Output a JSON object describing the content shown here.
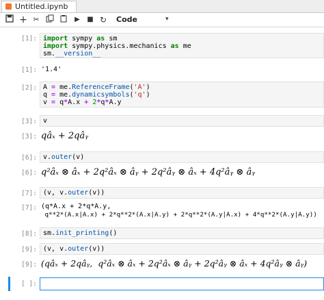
{
  "tab": {
    "title": "Untitled.ipynb"
  },
  "toolbar": {
    "buttons": [
      "save-icon",
      "add-cell-icon",
      "cut-icon",
      "copy-icon",
      "paste-icon",
      "run-icon",
      "stop-icon",
      "restart-icon"
    ],
    "cell_type": "Code"
  },
  "cells": [
    {
      "in_prompt": "[1]:",
      "code": [
        "import sympy as sm",
        "import sympy.physics.mechanics as me",
        "sm.__version__"
      ],
      "out_prompt": "[1]:",
      "output": "'1.4'"
    },
    {
      "in_prompt": "[2]:",
      "code": [
        "A = me.ReferenceFrame('A')",
        "q = me.dynamicsymbols('q')",
        "v = q*A.x + 2*q*A.y"
      ]
    },
    {
      "in_prompt": "[3]:",
      "code": [
        "v"
      ],
      "out_prompt": "[3]:",
      "output": "qâₓ + 2qâᵧ"
    },
    {
      "in_prompt": "[6]:",
      "code": [
        "v.outer(v)"
      ],
      "out_prompt": "[6]:",
      "output": "q²âₓ ⊗ âₓ + 2q²âₓ ⊗ âᵧ + 2q²âᵧ ⊗ âₓ + 4q²âᵧ ⊗ âᵧ"
    },
    {
      "in_prompt": "[7]:",
      "code": [
        "(v, v.outer(v))"
      ],
      "out_prompt": "[7]:",
      "output": [
        "(q*A.x + 2*q*A.y,",
        " q**2*(A.x|A.x) + 2*q**2*(A.x|A.y) + 2*q**2*(A.y|A.x) + 4*q**2*(A.y|A.y))"
      ]
    },
    {
      "in_prompt": "[8]:",
      "code": [
        "sm.init_printing()"
      ]
    },
    {
      "in_prompt": "[9]:",
      "code": [
        "(v, v.outer(v))"
      ],
      "out_prompt": "[9]:",
      "output": "(qâₓ + 2qâᵧ,  q²âₓ ⊗ âₓ + 2q²âₓ ⊗ âᵧ + 2q²âᵧ ⊗ âₓ + 4q²âᵧ ⊗ âᵧ)"
    },
    {
      "in_prompt": "[ ]:"
    }
  ]
}
